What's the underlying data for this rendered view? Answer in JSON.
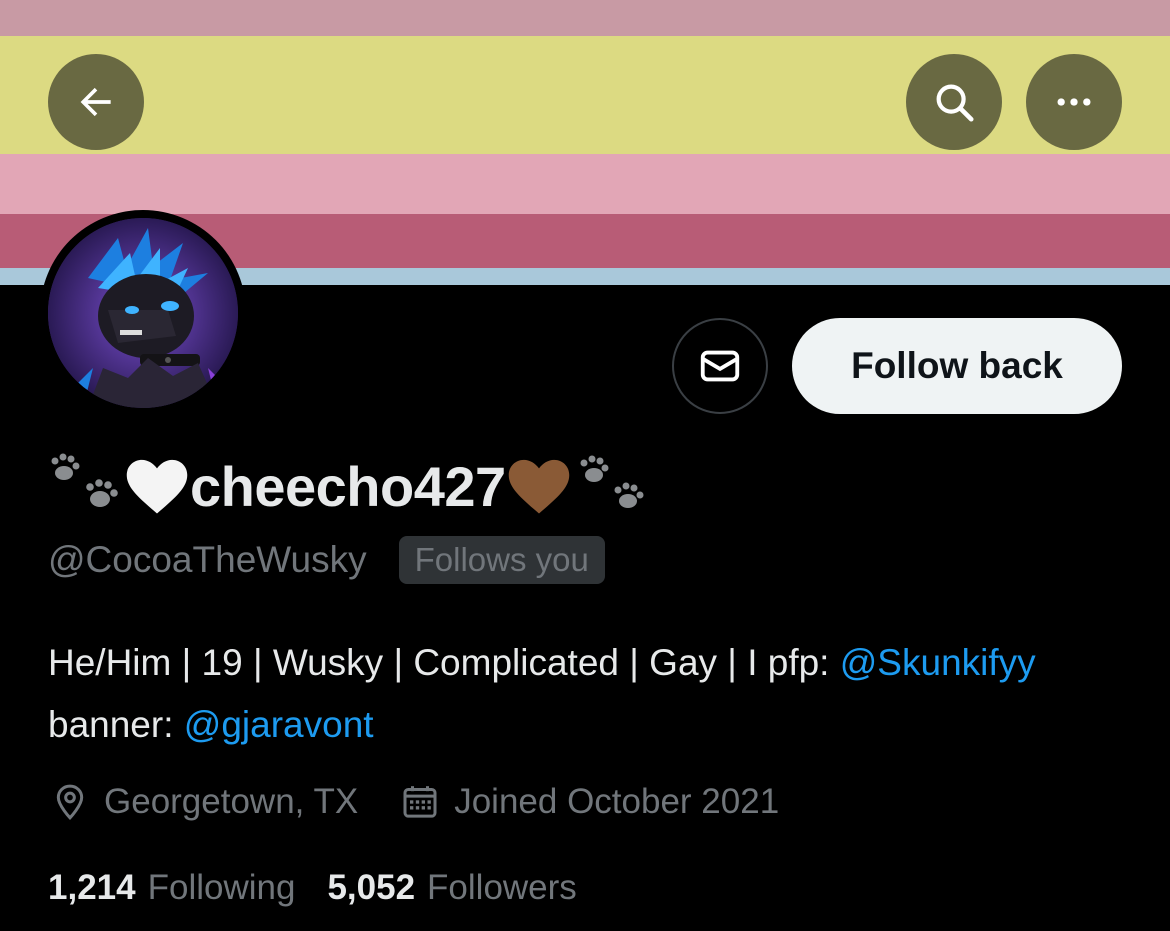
{
  "banner": {
    "stripe_colors": [
      "#c89aa4",
      "#dcda82",
      "#e2a6b6",
      "#b85c76",
      "#a9c8da"
    ]
  },
  "nav": {
    "back_icon": "arrow-left-icon",
    "search_icon": "search-icon",
    "more_icon": "more-horizontal-icon"
  },
  "profile": {
    "display_name": "cheecho427",
    "handle": "@CocoaTheWusky",
    "follows_you_label": "Follows you",
    "bio": {
      "text_1": "He/Him | 19 | Wusky | Complicated | Gay | I pfp: ",
      "mention_1": "@Skunkifyy",
      "text_2": " banner: ",
      "mention_2": "@gjaravont"
    },
    "location": "Georgetown, TX",
    "joined": "Joined October 2021",
    "following_count": "1,214",
    "following_label": "Following",
    "followers_count": "5,052",
    "followers_label": "Followers"
  },
  "actions": {
    "message_icon": "envelope-icon",
    "follow_back_label": "Follow back"
  },
  "colors": {
    "accent_link": "#1d9bf0",
    "muted_text": "#71767b",
    "background": "#000000"
  }
}
